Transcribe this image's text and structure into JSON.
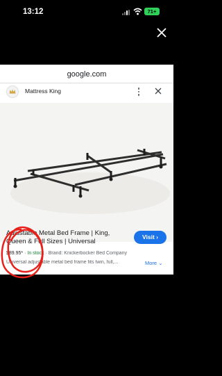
{
  "status_bar": {
    "time": "13:12",
    "battery": "71+"
  },
  "page": {
    "domain": "google.com",
    "site_name": "Mattress King",
    "product": {
      "title": "Adjustable Metal Bed Frame | King, Queen & Full Sizes | Universal",
      "price": "$89.95*",
      "stock": "In stock",
      "brand": "Brand: Knickerbocker Bed Company",
      "description": "Universal adjustable metal bed frame fits twin, full,...",
      "more_label": "More",
      "visit_label": "Visit"
    }
  },
  "colors": {
    "accent": "#1a73e8",
    "stock": "#188038",
    "annotation": "#e8201a"
  },
  "icons": [
    "close-icon",
    "crown-icon",
    "more-vert-icon",
    "lens-icon",
    "chevron-right-icon",
    "chevron-down-icon",
    "wifi-icon",
    "signal-icon"
  ]
}
